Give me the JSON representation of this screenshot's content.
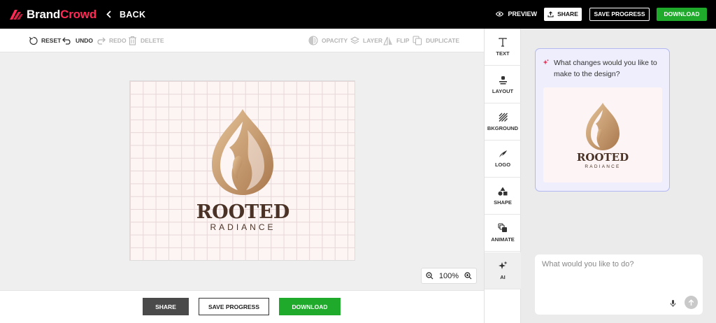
{
  "brand": {
    "name_part1": "Brand",
    "name_part2": "Crowd",
    "accent": "#ff2a55"
  },
  "topbar": {
    "back_label": "BACK",
    "preview_label": "PREVIEW",
    "share_label": "SHARE",
    "save_label": "SAVE PROGRESS",
    "download_label": "DOWNLOAD"
  },
  "toolbar": {
    "reset": "RESET",
    "undo": "UNDO",
    "redo": "REDO",
    "delete": "DELETE",
    "opacity": "OPACITY",
    "layer": "LAYER",
    "flip": "FLIP",
    "duplicate": "DUPLICATE"
  },
  "design": {
    "title": "ROOTED",
    "subtitle": "RADIANCE",
    "title_color": "#4a3326",
    "gold_light": "#e6c49a",
    "gold_dark": "#a9774c"
  },
  "zoom": {
    "level": "100%"
  },
  "bottombar": {
    "share_label": "SHARE",
    "save_label": "SAVE PROGRESS",
    "download_label": "DOWNLOAD"
  },
  "sidepanel": {
    "items": [
      {
        "label": "TEXT",
        "icon": "text-icon"
      },
      {
        "label": "LAYOUT",
        "icon": "layout-icon"
      },
      {
        "label": "BKGROUND",
        "icon": "background-icon"
      },
      {
        "label": "LOGO",
        "icon": "logo-icon"
      },
      {
        "label": "SHAPE",
        "icon": "shape-icon"
      },
      {
        "label": "ANIMATE",
        "icon": "animate-icon"
      },
      {
        "label": "AI",
        "icon": "sparkle-icon"
      }
    ]
  },
  "ai": {
    "question": "What changes would you like to make to the design?",
    "placeholder": "What would you like to do?",
    "card_border": "#b3b8f0",
    "card_bg": "#eeeefc"
  },
  "colors": {
    "download_green": "#1faa2b",
    "share_dark": "#4a4a4a"
  }
}
